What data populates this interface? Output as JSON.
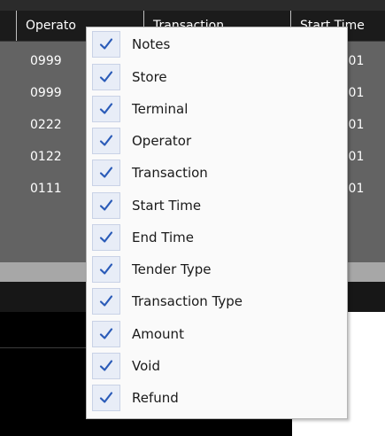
{
  "grid": {
    "columns": [
      "Operato",
      "Transaction",
      "Start Time"
    ],
    "rows": [
      {
        "operator": "0999",
        "start": "2/201"
      },
      {
        "operator": "0999",
        "start": "2/201"
      },
      {
        "operator": "0222",
        "start": "2/201"
      },
      {
        "operator": "0122",
        "start": "2/201"
      },
      {
        "operator": "0111",
        "start": "2/201"
      }
    ]
  },
  "menu": {
    "items": [
      {
        "label": "Notes",
        "checked": true
      },
      {
        "label": "Store",
        "checked": true
      },
      {
        "label": "Terminal",
        "checked": true
      },
      {
        "label": "Operator",
        "checked": true
      },
      {
        "label": "Transaction",
        "checked": true
      },
      {
        "label": "Start Time",
        "checked": true
      },
      {
        "label": "End Time",
        "checked": true
      },
      {
        "label": "Tender Type",
        "checked": true
      },
      {
        "label": "Transaction Type",
        "checked": true
      },
      {
        "label": "Amount",
        "checked": true
      },
      {
        "label": "Void",
        "checked": true
      },
      {
        "label": "Refund",
        "checked": true
      }
    ],
    "check_color": "#2a5bb8"
  }
}
